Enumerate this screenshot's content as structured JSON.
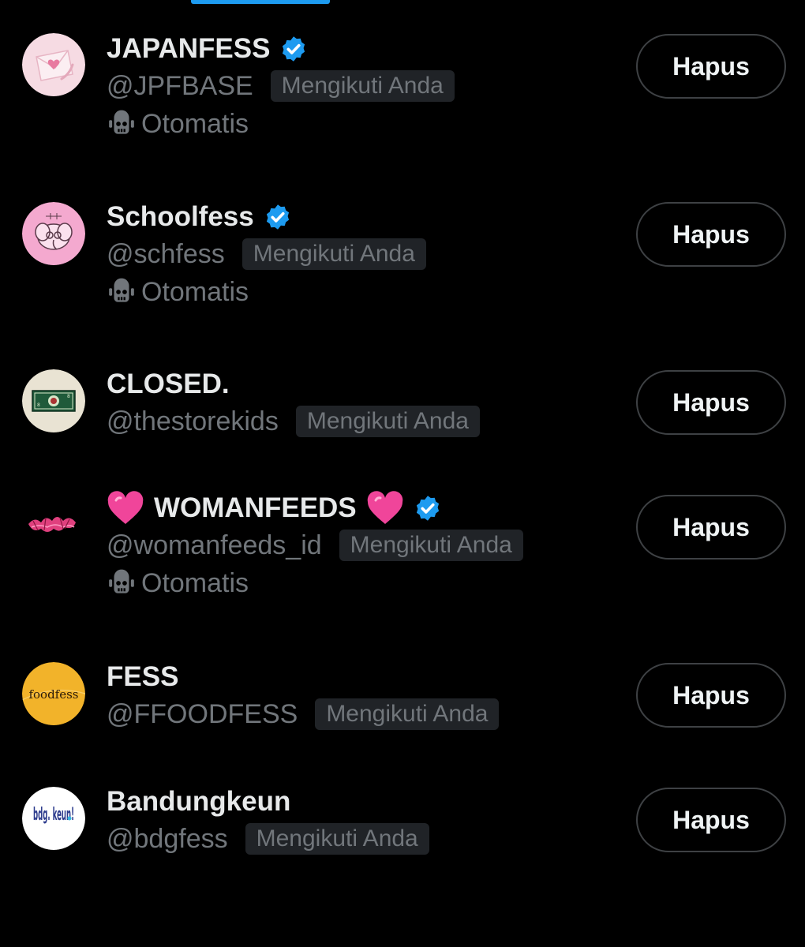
{
  "accounts": [
    {
      "name": "JAPANFESS",
      "handle": "@JPFBASE",
      "follows_you_label": "Mengikuti Anda",
      "automated_label": "Otomatis",
      "verified": true,
      "remove_label": "Hapus",
      "avatar_icon": "envelope-heart-avatar"
    },
    {
      "name": "Schoolfess",
      "handle": "@schfess",
      "follows_you_label": "Mengikuti Anda",
      "automated_label": "Otomatis",
      "verified": true,
      "remove_label": "Hapus",
      "avatar_icon": "elephant-doodle-avatar"
    },
    {
      "name": "CLOSED.",
      "handle": "@thestorekids",
      "follows_you_label": "Mengikuti Anda",
      "verified": false,
      "remove_label": "Hapus",
      "avatar_icon": "banknote-avatar"
    },
    {
      "name": "WOMANFEEDS",
      "name_decoration": "pink-heart-emoji",
      "handle": "@womanfeeds_id",
      "follows_you_label": "Mengikuti Anda",
      "automated_label": "Otomatis",
      "verified": true,
      "remove_label": "Hapus",
      "avatar_icon": "pink-graffiti-logo-avatar"
    },
    {
      "name": "FESS",
      "handle": "@FFOODFESS",
      "follows_you_label": "Mengikuti Anda",
      "verified": false,
      "remove_label": "Hapus",
      "avatar_icon": "foodfess-logo-avatar",
      "avatar_logo_text": "foodfess"
    },
    {
      "name": "Bandungkeun",
      "handle": "@bdgfess",
      "follows_you_label": "Mengikuti Anda",
      "verified": false,
      "remove_label": "Hapus",
      "avatar_icon": "bdg-logo-avatar",
      "avatar_logo_text": "bdg. keun!"
    }
  ],
  "colors": {
    "background": "#000000",
    "primary_text": "#e7e9ea",
    "secondary_text": "#71767b",
    "badge_bg": "#202327",
    "verified_blue": "#1d9bf0",
    "tab_indicator": "#1d9bf0",
    "button_border": "#3e4144"
  }
}
